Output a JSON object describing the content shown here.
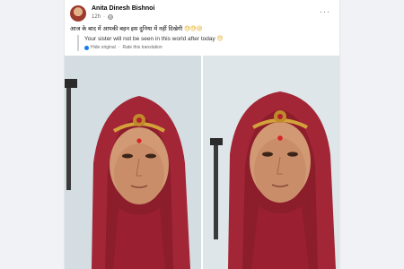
{
  "post": {
    "author": "Anita Dinesh Bishnoi",
    "time": "12h",
    "privacy_icon": "globe-icon",
    "more_icon": "more-options-icon",
    "caption": "आज के बाद में आपकी बहन इस दुनिया में नहीं दिखेगी",
    "caption_emoji": "😓😓😢",
    "translation": {
      "text": "Your sister will not be seen in this world after today",
      "emoji": "😓",
      "hide_label": "Hide original",
      "rate_label": "Rate this translation"
    },
    "photos": [
      "woman-in-red-veil-photo-left",
      "woman-in-red-veil-photo-right"
    ]
  }
}
